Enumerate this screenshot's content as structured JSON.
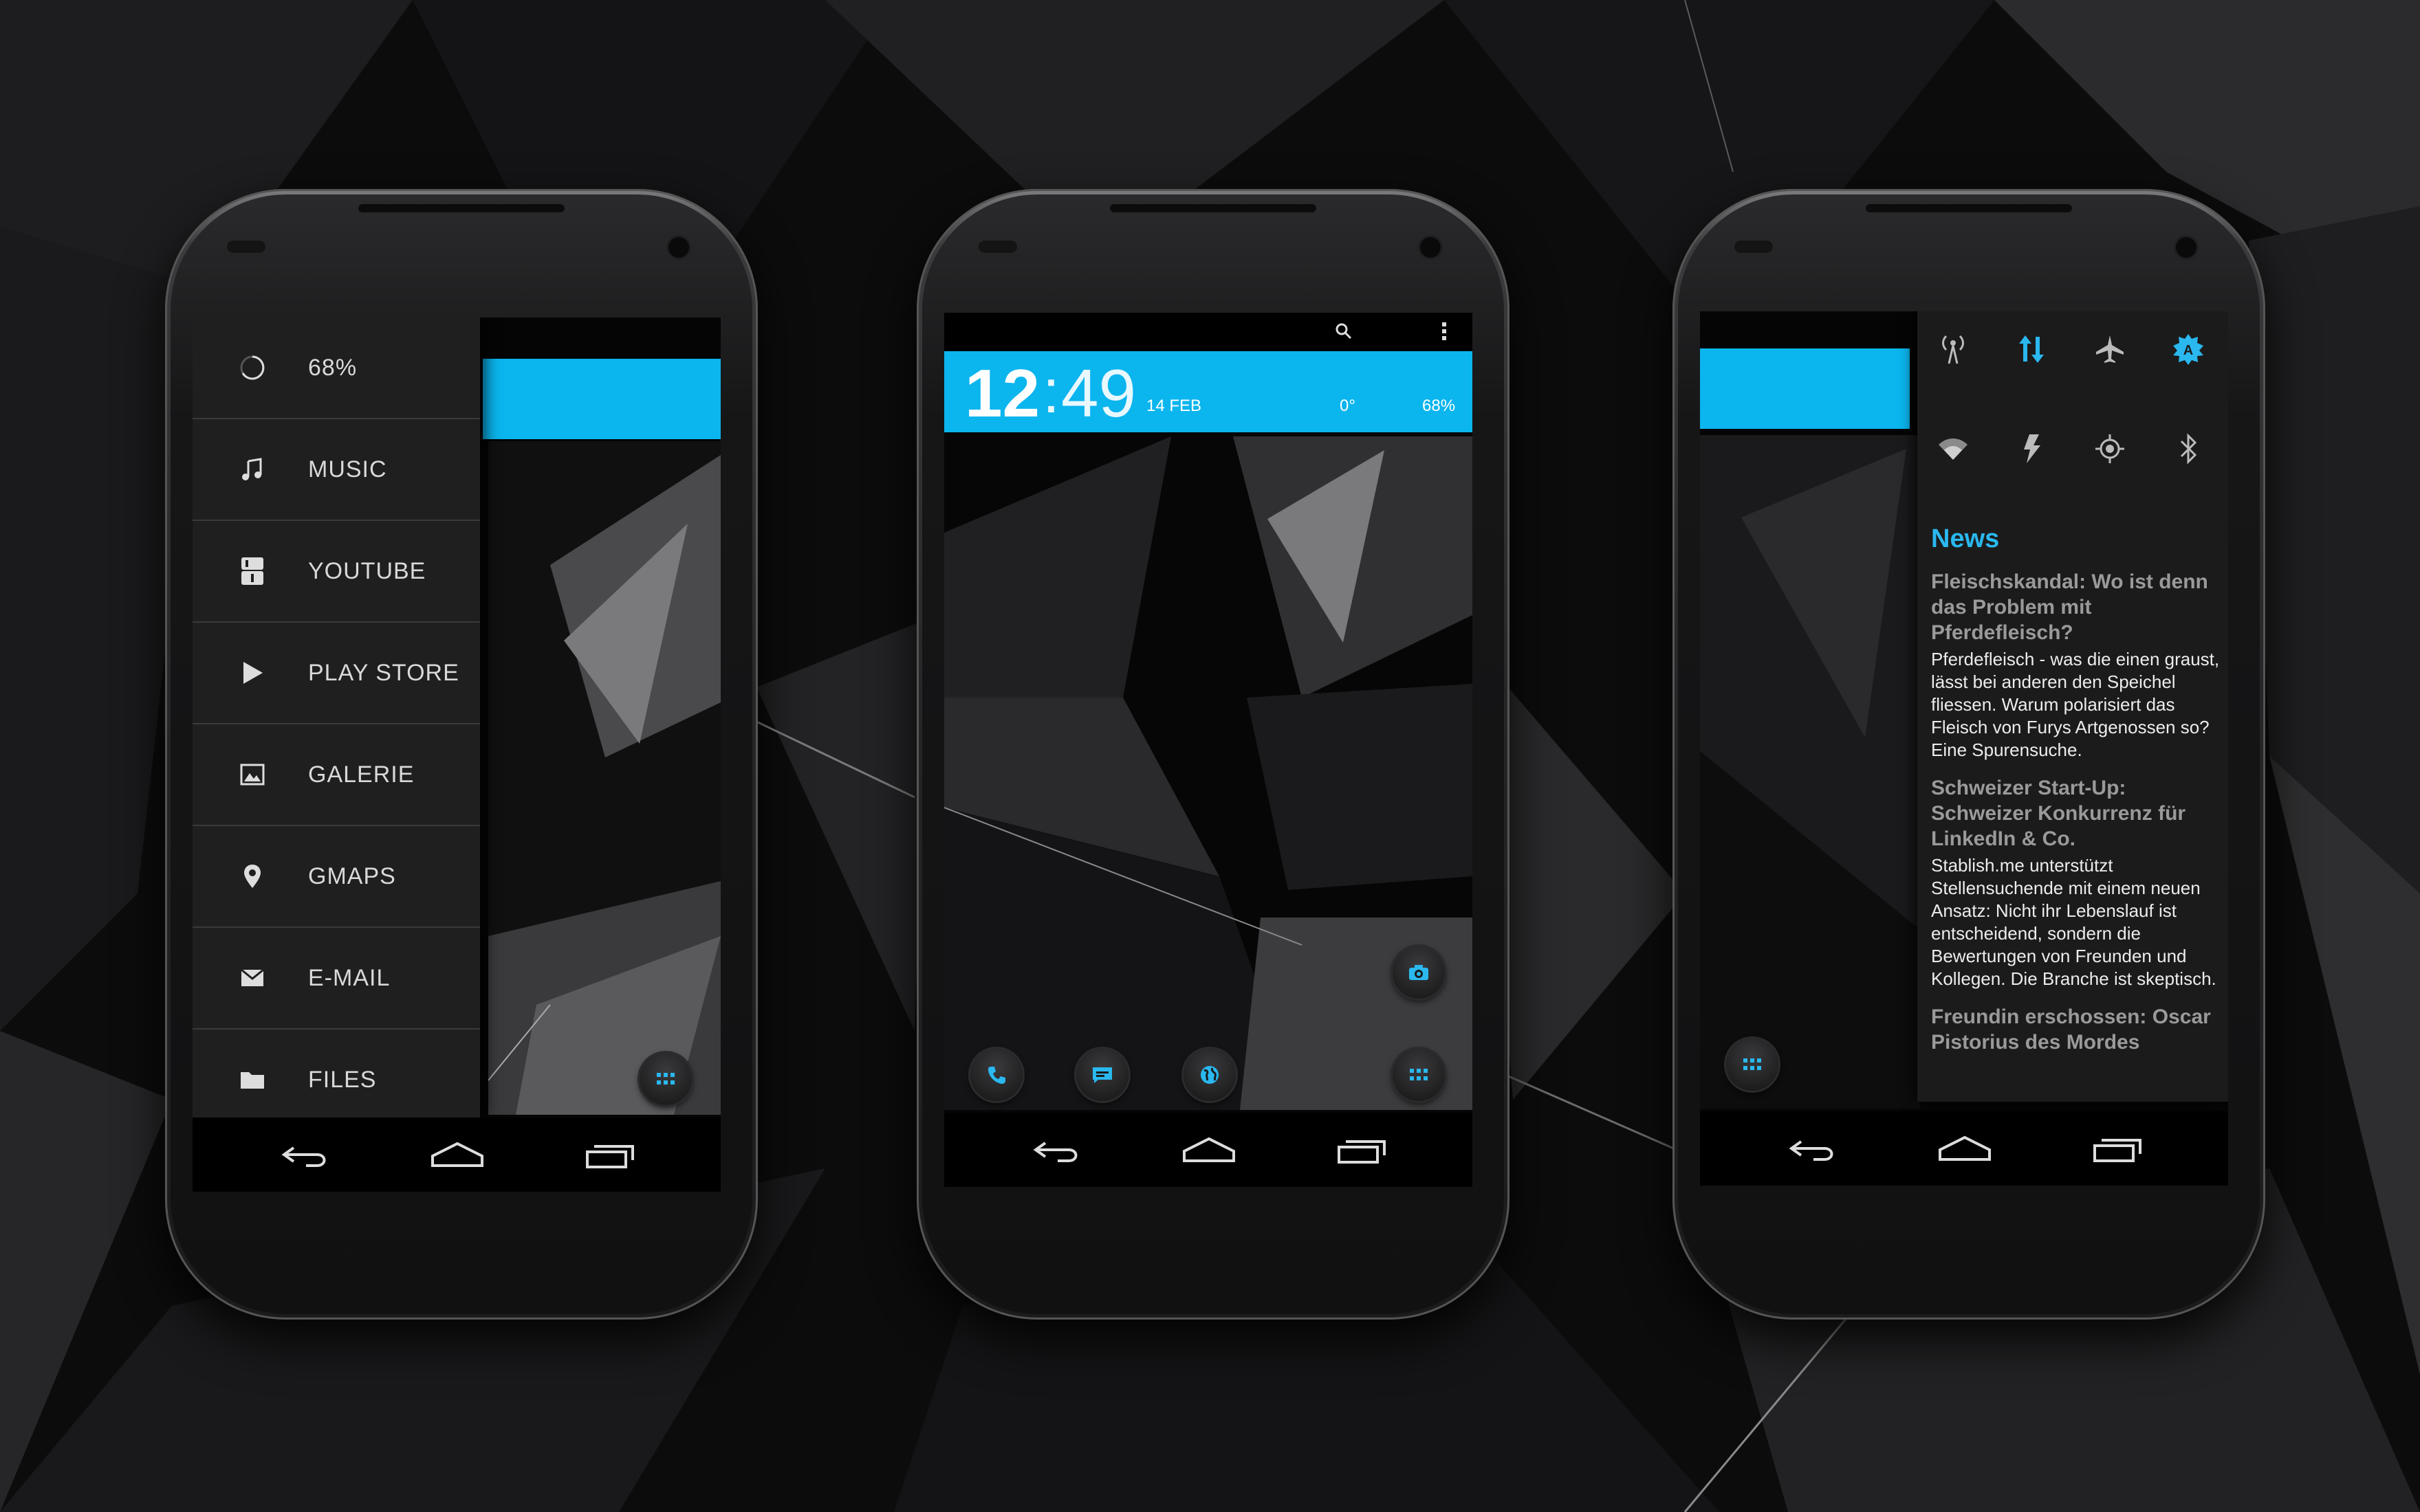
{
  "colors": {
    "accent": "#0bb5ee",
    "panel": "#1f1f20",
    "background": "#0b0b0c"
  },
  "phone1": {
    "menu": [
      {
        "icon": "progress-ring-icon",
        "label": "68%"
      },
      {
        "icon": "music-note-icon",
        "label": "MUSIC"
      },
      {
        "icon": "youtube-icon",
        "label": "YOUTUBE"
      },
      {
        "icon": "play-icon",
        "label": "PLAY STORE"
      },
      {
        "icon": "image-icon",
        "label": "GALERIE"
      },
      {
        "icon": "map-pin-icon",
        "label": "GMAPS"
      },
      {
        "icon": "mail-icon",
        "label": "E-MAIL"
      },
      {
        "icon": "folder-icon",
        "label": "FILES"
      }
    ]
  },
  "phone2": {
    "clock_hours": "12",
    "clock_colon": ":",
    "clock_minutes": "49",
    "date": "14 FEB",
    "temperature": "0°",
    "battery": "68%",
    "dock": [
      "phone-icon",
      "messages-icon",
      "browser-icon",
      "apps-grid-icon"
    ]
  },
  "phone3": {
    "toggles_row1": [
      "signal-icon",
      "data-sync-icon",
      "airplane-icon",
      "auto-brightness-icon"
    ],
    "toggles_row2": [
      "wifi-icon",
      "flash-icon",
      "gps-icon",
      "bluetooth-icon"
    ],
    "news_title": "News",
    "articles": [
      {
        "headline": "Fleischskandal: Wo ist denn das Problem mit Pferdefleisch?",
        "body": "Pferdefleisch - was die einen graust, lässt bei anderen den Speichel fliessen. Warum polarisiert das Fleisch von Furys Artgenossen so? Eine Spurensuche."
      },
      {
        "headline": "Schweizer Start-Up: Schweizer Konkurrenz für LinkedIn & Co.",
        "body": "Stablish.me unterstützt Stellensuchende mit einem neuen Ansatz: Nicht ihr Lebenslauf ist entscheidend, sondern die Bewertungen von Freunden und Kollegen. Die Branche ist skeptisch."
      },
      {
        "headline": "Freundin erschossen: Oscar Pistorius des Mordes",
        "body": ""
      }
    ]
  }
}
